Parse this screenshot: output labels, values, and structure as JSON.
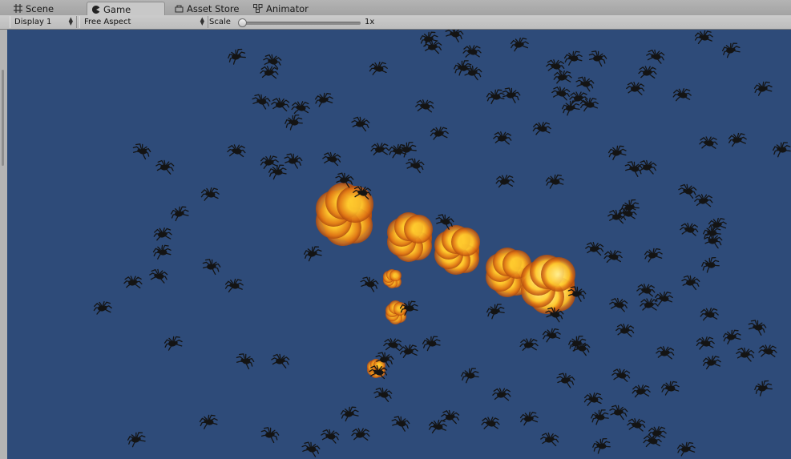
{
  "tabs": [
    {
      "label": "Scene",
      "icon": "grid-icon",
      "active": false
    },
    {
      "label": "Game",
      "icon": "pacman-icon",
      "active": true
    },
    {
      "label": "Asset Store",
      "icon": "store-icon",
      "active": false
    },
    {
      "label": "Animator",
      "icon": "animator-icon",
      "active": false
    }
  ],
  "toolbar": {
    "display": "Display 1",
    "aspect": "Free Aspect",
    "scale_label": "Scale",
    "scale_value": "1x"
  },
  "scene": {
    "background_color": "#2e4b79",
    "enemy": "spider",
    "enemy_color": "#141414",
    "effect": "fire-explosion",
    "fire_colors": [
      "#fff4a0",
      "#ffcb2e",
      "#e07514",
      "#8a2a0a"
    ]
  }
}
